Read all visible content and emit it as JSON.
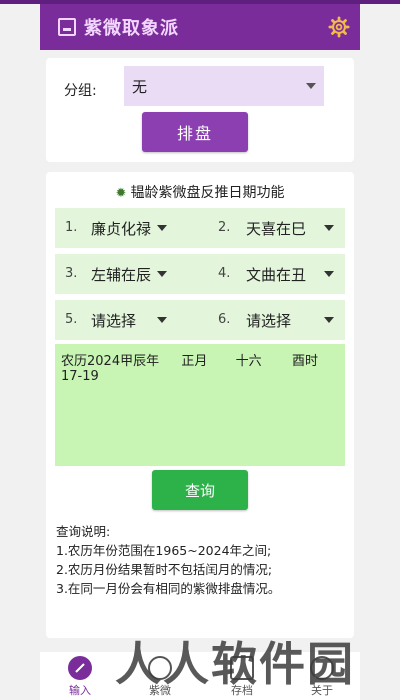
{
  "app": {
    "title": "紫微取象派",
    "icon": "calendar-icon",
    "settings_icon": "gear-icon"
  },
  "group": {
    "label": "分组:",
    "value": "无"
  },
  "paipan_button": "排盘",
  "section": {
    "icon": "star-icon",
    "title": "韫龄紫微盘反推日期功能"
  },
  "selectors": [
    {
      "index": "1.",
      "value": "廉贞化禄"
    },
    {
      "index": "2.",
      "value": "天喜在巳"
    },
    {
      "index": "3.",
      "value": "左辅在辰"
    },
    {
      "index": "4.",
      "value": "文曲在丑"
    },
    {
      "index": "5.",
      "value": "请选择"
    },
    {
      "index": "6.",
      "value": "请选择"
    }
  ],
  "result": {
    "year": "农历2024甲辰年",
    "month": "正月",
    "day": "十六",
    "hour": "酉时17-19"
  },
  "query_button": "查询",
  "notes": {
    "title": "查询说明:",
    "lines": [
      "1.农历年份范围在1965~2024年之间;",
      "2.农历月份结果暂时不包括闰月的情况;",
      "3.在同一月份会有相同的紫微排盘情况。"
    ]
  },
  "nav": [
    {
      "label": "输入",
      "icon": "pencil-icon"
    },
    {
      "label": "紫微",
      "icon": "ziwei-icon"
    },
    {
      "label": "存档",
      "icon": "archive-icon"
    },
    {
      "label": "关于",
      "icon": "info-icon"
    }
  ],
  "watermark": "人人软件园",
  "colors": {
    "primary": "#7a2d9a",
    "button_purple": "#8c3fb0",
    "button_green": "#2db24a",
    "select_bg": "#ebdcf5",
    "green_box": "#e3f6dc",
    "result_bg": "#c8f4b4"
  }
}
